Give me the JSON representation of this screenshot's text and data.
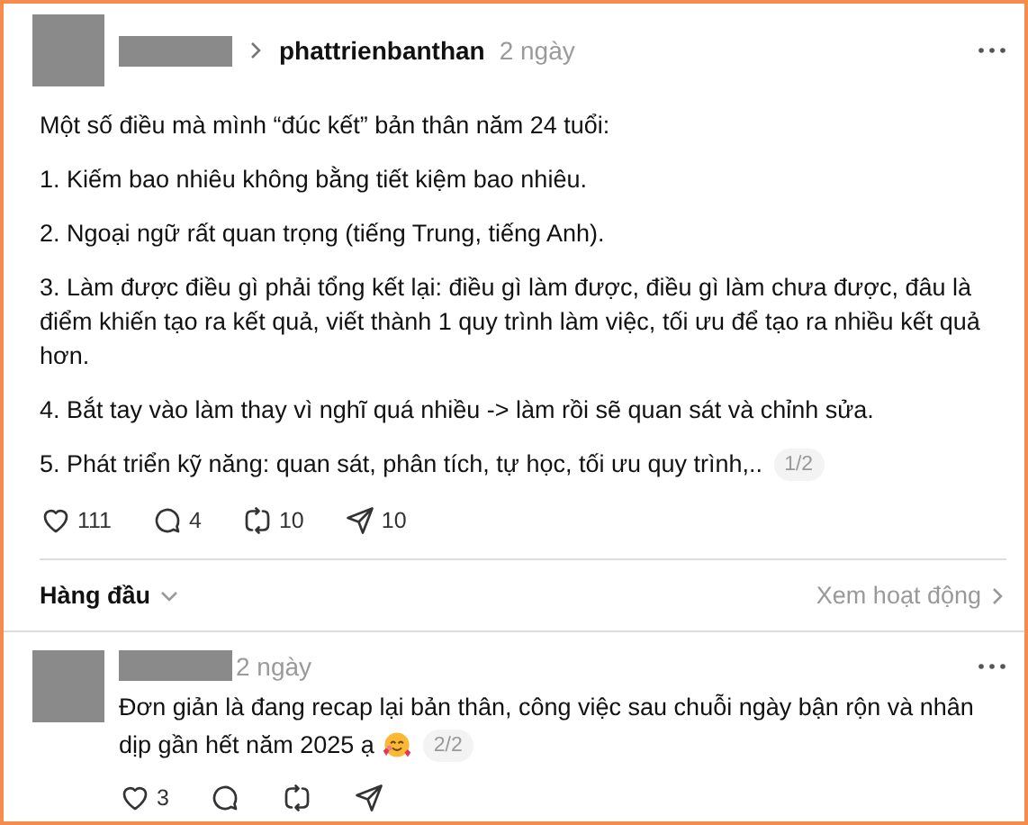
{
  "post": {
    "username": "phattrienbanthan",
    "time": "2 ngày",
    "paragraphs": [
      "Một số điều mà mình “đúc kết” bản thân năm 24 tuổi:",
      "1. Kiếm bao nhiêu không bằng tiết kiệm bao nhiêu.",
      "2. Ngoại ngữ rất quan trọng (tiếng Trung, tiếng Anh).",
      "3. Làm được điều gì phải tổng kết lại: điều gì làm được, điều gì làm chưa được, đâu là điểm khiến tạo ra kết quả, viết thành 1 quy trình làm việc, tối ưu để tạo ra nhiều kết quả hơn.",
      "4. Bắt tay vào làm thay vì nghĩ quá nhiều -> làm rồi sẽ quan sát và chỉnh sửa.",
      "5. Phát triển kỹ năng: quan sát, phân tích, tự học, tối ưu quy trình,.."
    ],
    "page": "1/2",
    "actions": [
      {
        "kind": "like",
        "count": "111"
      },
      {
        "kind": "reply",
        "count": "4"
      },
      {
        "kind": "repost",
        "count": "10"
      },
      {
        "kind": "share",
        "count": "10"
      }
    ]
  },
  "sort": {
    "label": "Hàng đầu"
  },
  "activity_link": "Xem hoạt động",
  "reply": {
    "time": "2 ngày",
    "text_lines": [
      "Đơn giản là đang recap lại bản thân, công việc sau chuỗi ngày bận rộn và nhân",
      "dịp gần hết năm 2025 ạ"
    ],
    "page": "2/2",
    "actions": [
      {
        "kind": "like",
        "count": "3"
      },
      {
        "kind": "reply"
      },
      {
        "kind": "repost"
      },
      {
        "kind": "share"
      }
    ]
  }
}
